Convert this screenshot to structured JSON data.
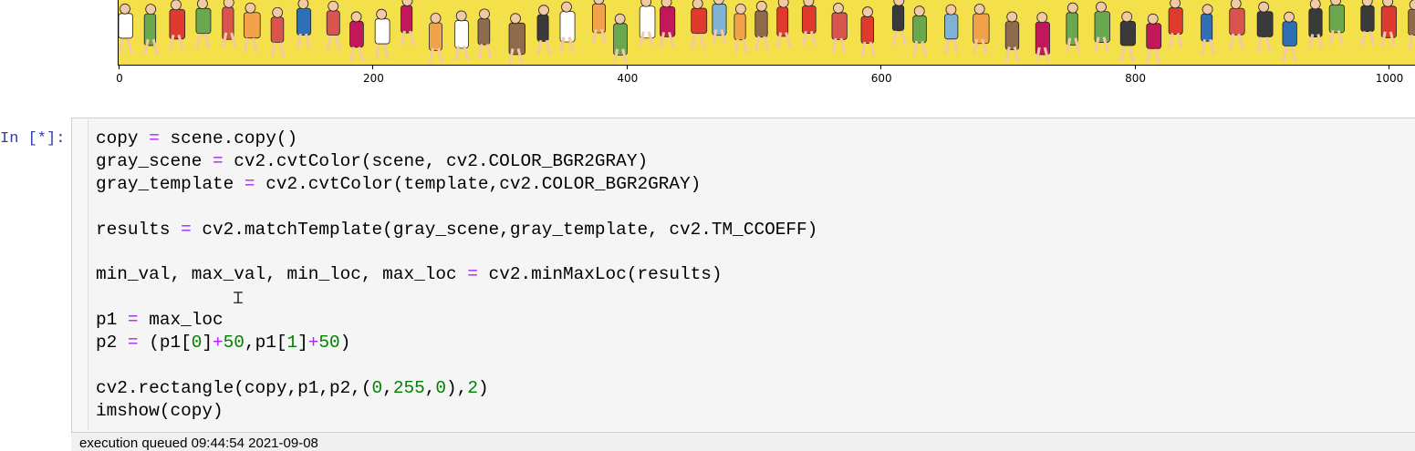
{
  "output": {
    "image_description_icon": "image-output",
    "x_axis_ticks": [
      "0",
      "200",
      "400",
      "600",
      "800",
      "1000"
    ]
  },
  "cell": {
    "prompt": "In [*]:",
    "code_lines": [
      "copy = scene.copy()",
      "gray_scene = cv2.cvtColor(scene, cv2.COLOR_BGR2GRAY)",
      "gray_template = cv2.cvtColor(template,cv2.COLOR_BGR2GRAY)",
      "",
      "results = cv2.matchTemplate(gray_scene,gray_template, cv2.TM_CCOEFF)",
      "",
      "min_val, max_val, min_loc, max_loc = cv2.minMaxLoc(results)",
      "",
      "p1 = max_loc",
      "p2 = (p1[0]+50,p1[1]+50)",
      "",
      "cv2.rectangle(copy,p1,p2,(0,255,0),2)",
      "imshow(copy)"
    ],
    "status": "execution queued 09:44:54 2021-09-08"
  },
  "colors": {
    "prompt": "#303f9f",
    "keyword_operator": "#aa22ff",
    "number": "#008000",
    "image_background": "#f2df3c"
  }
}
